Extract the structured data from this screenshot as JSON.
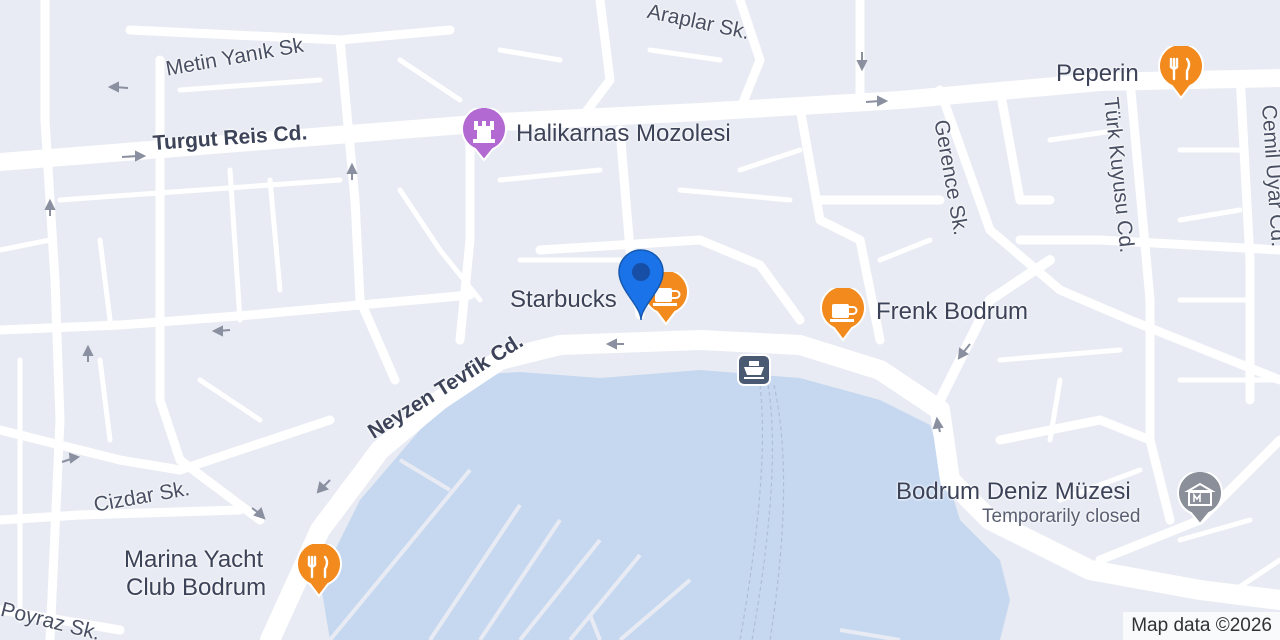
{
  "map": {
    "colors": {
      "land": "#e8ebf3",
      "road": "#ffffff",
      "water": "#c5d8f0",
      "food_poi": "#f28a1e",
      "landmark_poi": "#b26ad2",
      "museum_poi": "#8b8f9a",
      "location_pin": "#1a73e8"
    },
    "streets": {
      "araplar": "Araplar Sk.",
      "metin_yanik": "Metin Yanık Sk",
      "turgut_reis": "Turgut Reis Cd.",
      "neyzen_tevfik": "Neyzen Tevfik Cd.",
      "gerence": "Gerence Sk.",
      "turk_kuyusu": "Türk Kuyusu Cd.",
      "cemil_uyar": "Cemil Uyar Cd.",
      "cizdar": "Cizdar Sk.",
      "poyraz": "Poyraz Sk."
    },
    "pois": {
      "peperin": {
        "name": "Peperin",
        "icon": "restaurant-icon"
      },
      "halikarnas": {
        "name": "Halikarnas Mozolesi",
        "icon": "landmark-icon"
      },
      "starbucks": {
        "name": "Starbucks",
        "icon": "cafe-icon"
      },
      "frenk": {
        "name": "Frenk Bodrum",
        "icon": "cafe-icon"
      },
      "deniz_muzesi": {
        "name": "Bodrum Deniz Müzesi",
        "status": "Temporarily closed",
        "icon": "museum-icon"
      },
      "marina_line1": "Marina Yacht",
      "marina_line2": "Club Bodrum",
      "ferry": {
        "icon": "ferry-icon"
      }
    },
    "location_marker": {
      "icon": "location-pin-icon"
    },
    "attribution": "Map data ©2026"
  }
}
